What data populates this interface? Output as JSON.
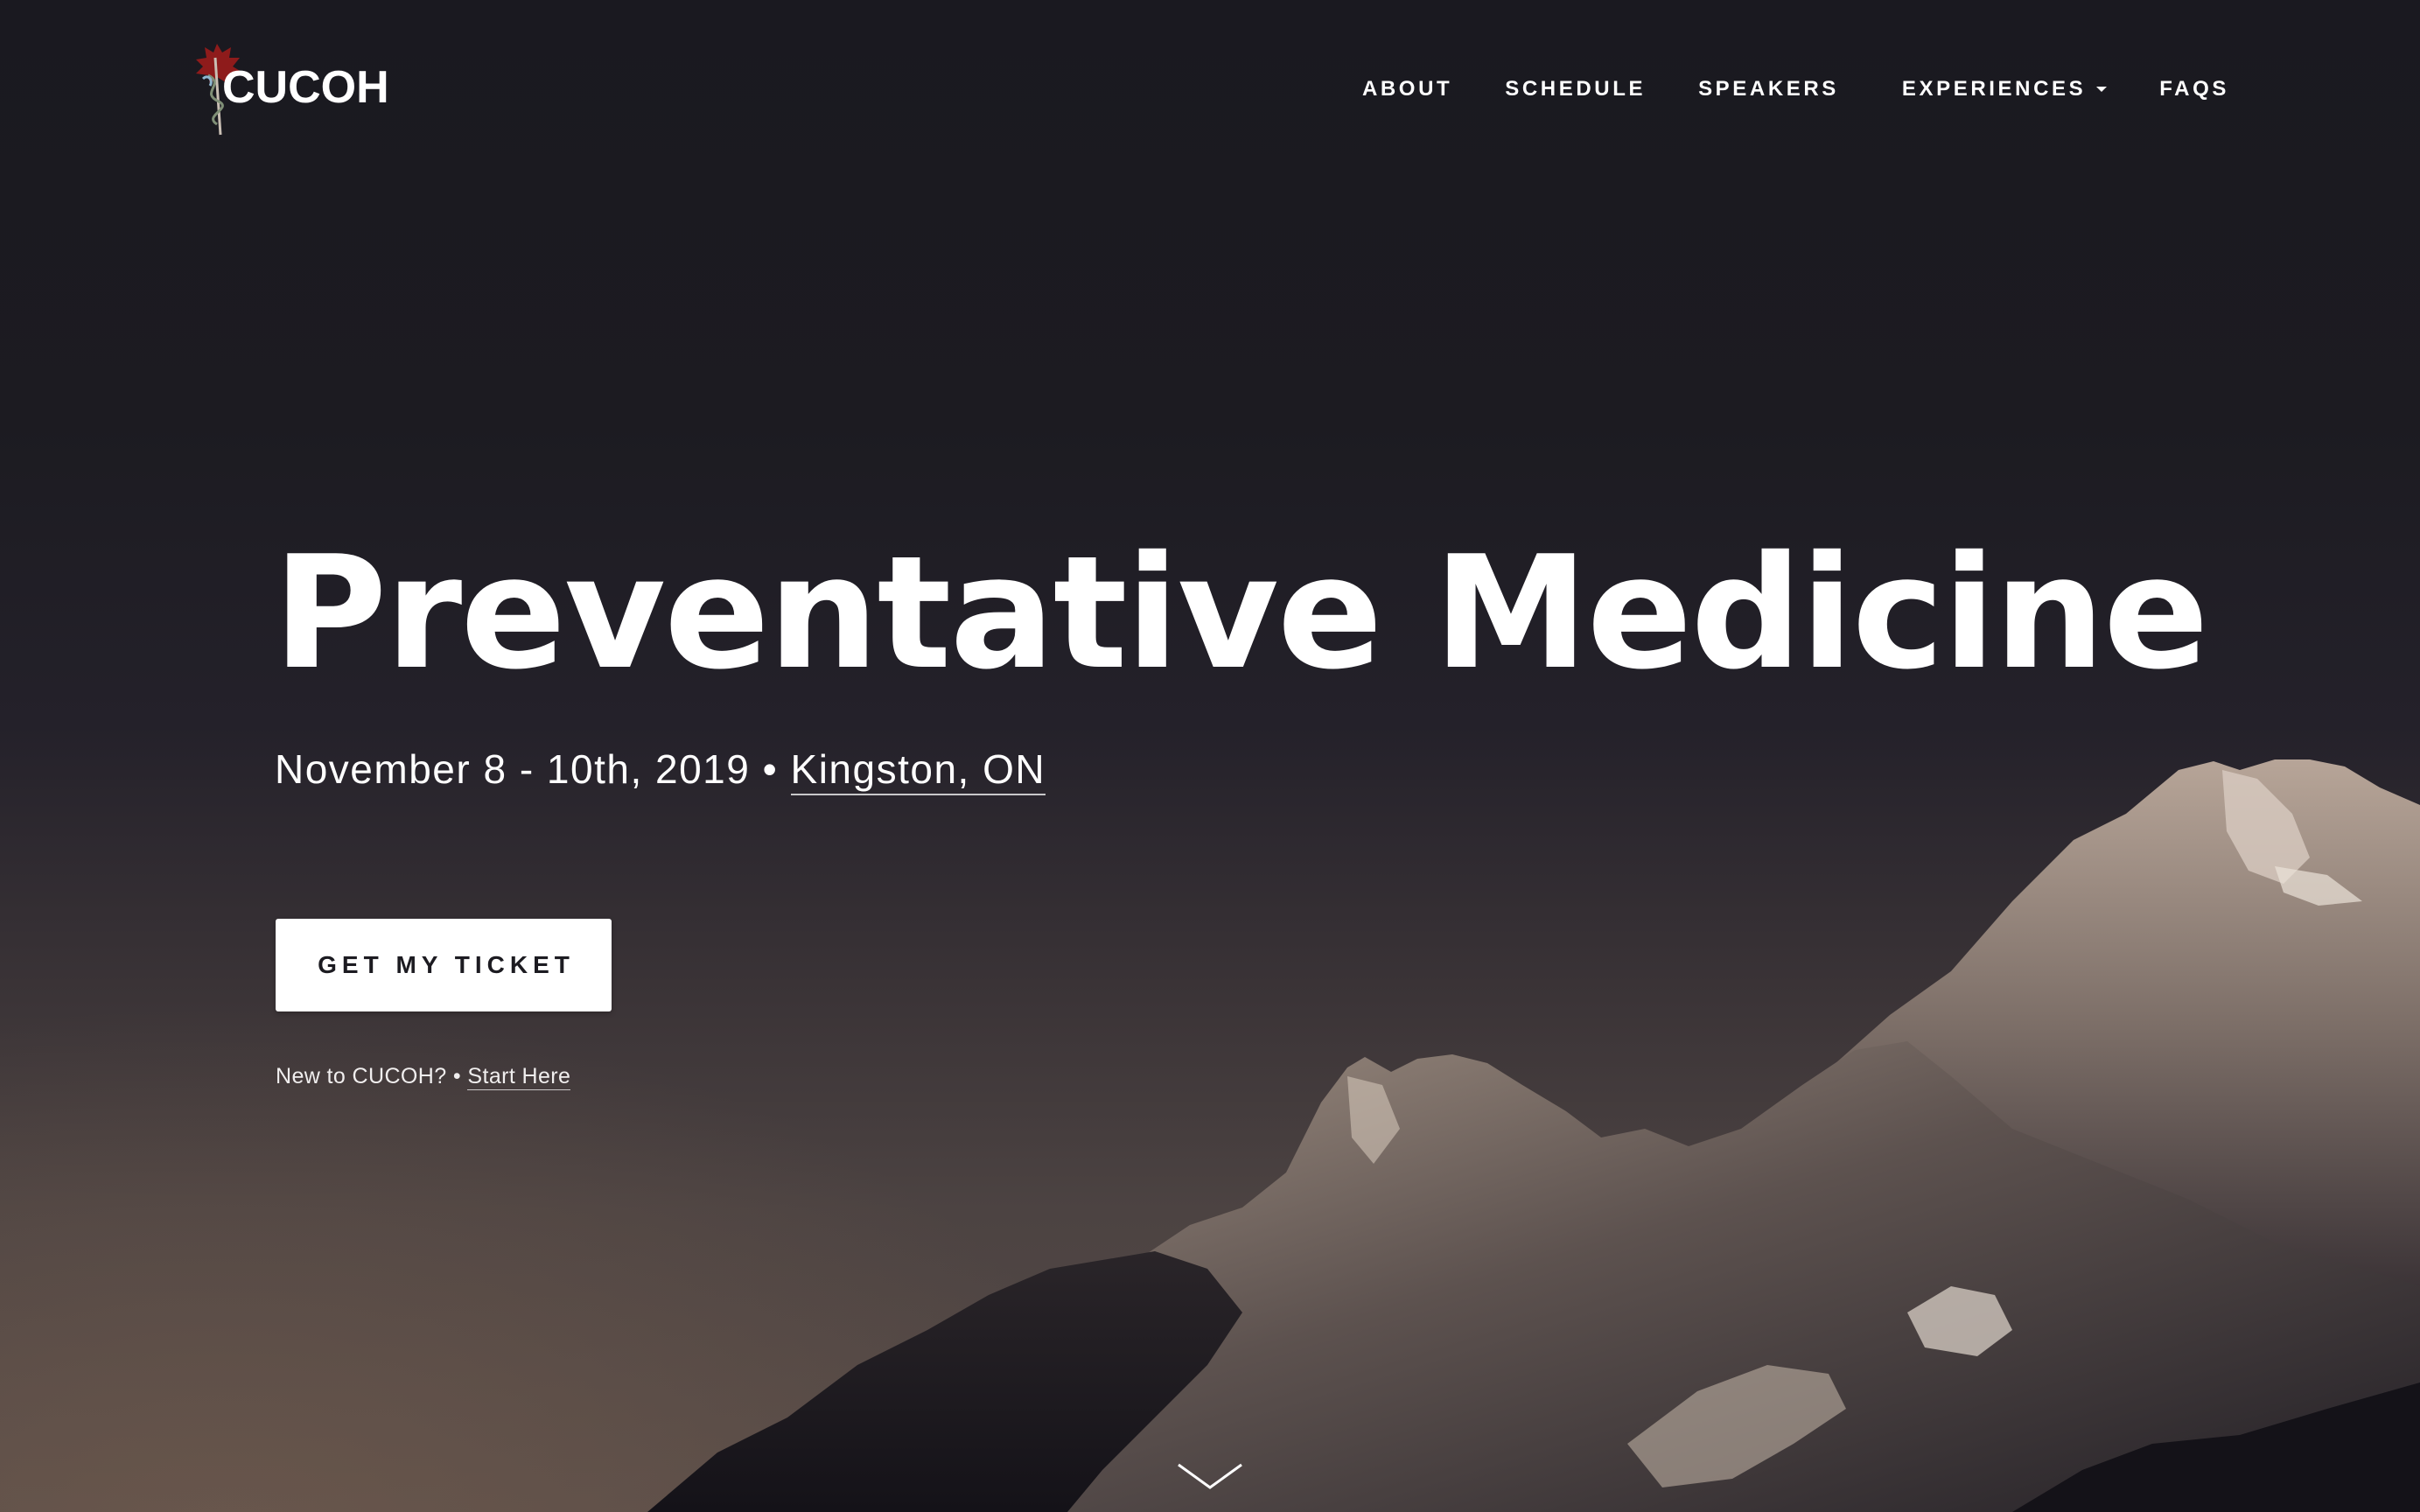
{
  "header": {
    "logo_text": "CUCOH",
    "nav": [
      {
        "label": "ABOUT"
      },
      {
        "label": "SCHEDULE"
      },
      {
        "label": "SPEAKERS"
      },
      {
        "label": "EXPERIENCES",
        "has_dropdown": true
      },
      {
        "label": "FAQS"
      }
    ]
  },
  "hero": {
    "title": "Preventative Medicine",
    "date": "November 8 - 10th, 2019",
    "separator": "•",
    "location": "Kingston, ON",
    "cta_label": "GET MY TICKET",
    "new_prompt": "New to CUCOH?",
    "new_separator": "•",
    "start_link": "Start Here"
  },
  "icons": {
    "logo": "maple-leaf-caduceus-logo-icon",
    "dropdown": "caret-down-icon",
    "scroll": "chevron-down-icon"
  },
  "colors": {
    "background_top": "#1a1920",
    "background_bottom": "#574b47",
    "text": "#ffffff",
    "button_bg": "#ffffff",
    "button_text": "#1c1b21",
    "logo_leaf": "#8e1b1b"
  }
}
